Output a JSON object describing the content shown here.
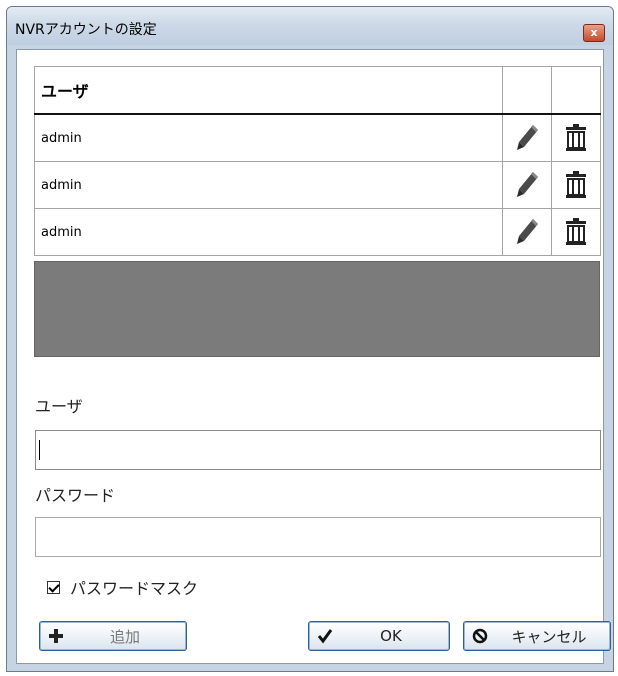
{
  "window": {
    "title": "NVRアカウントの設定",
    "close_glyph": "x"
  },
  "table": {
    "headers": [
      "ユーザ",
      "",
      ""
    ],
    "rows": [
      {
        "user": "admin",
        "edit_icon": "pencil-icon",
        "delete_icon": "trash-icon"
      },
      {
        "user": "admin",
        "edit_icon": "pencil-icon",
        "delete_icon": "trash-icon"
      },
      {
        "user": "admin",
        "edit_icon": "pencil-icon",
        "delete_icon": "trash-icon"
      }
    ]
  },
  "form": {
    "user_label": "ユーザ",
    "user_value": "",
    "password_label": "パスワード",
    "password_value": "",
    "mask_label": "パスワードマスク",
    "mask_checked": true
  },
  "buttons": {
    "add": {
      "label": "追加",
      "icon": "plus-icon",
      "enabled": false
    },
    "ok": {
      "label": "OK",
      "icon": "check-icon"
    },
    "cancel": {
      "label": "キャンセル",
      "icon": "cancel-icon"
    }
  },
  "colors": {
    "empty_area": "#7b7b7b",
    "close_button": "#c44a2c"
  }
}
